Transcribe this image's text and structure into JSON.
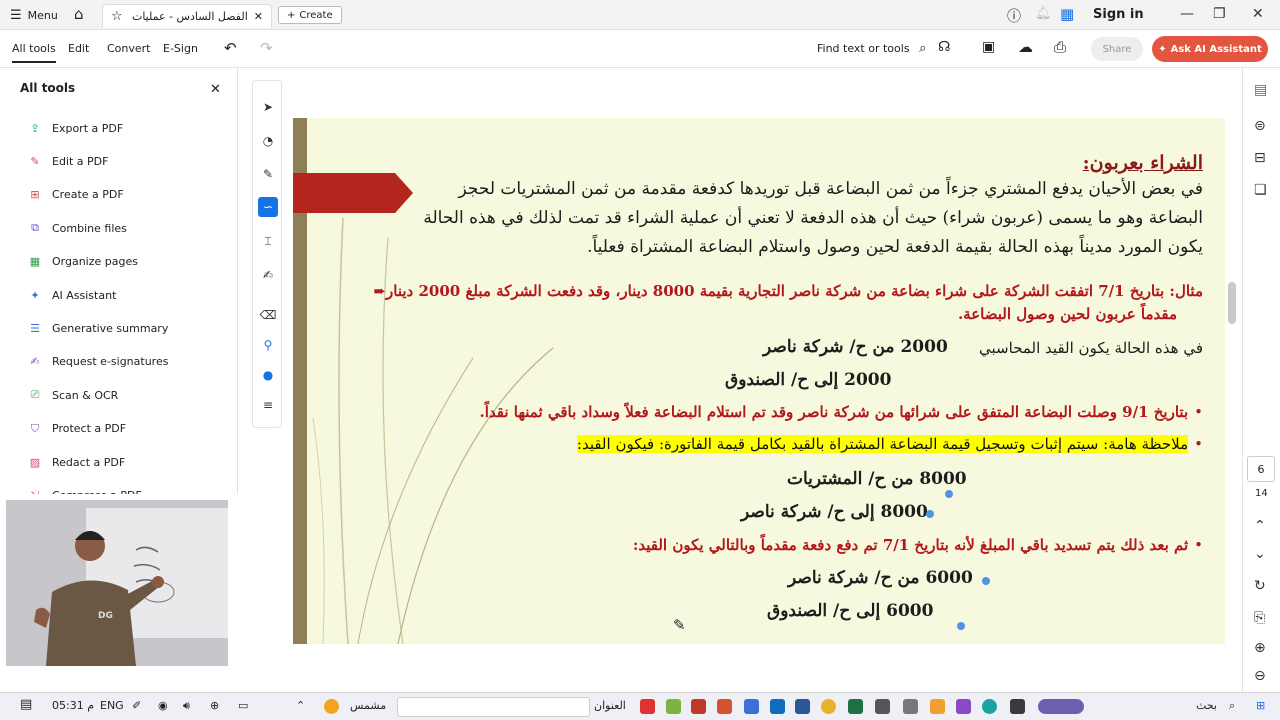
{
  "titlebar": {
    "menu_label": "Menu",
    "tab_title": "الفصل السادس - عمليات الب...",
    "create_label": "Create",
    "sign_in": "Sign in"
  },
  "menubar": {
    "all_tools": "All tools",
    "edit": "Edit",
    "convert": "Convert",
    "esign": "E-Sign",
    "find": "Find text or tools",
    "share": "Share",
    "ask_ai": "Ask AI Assistant"
  },
  "sidebar": {
    "title": "All tools",
    "items": [
      {
        "label": "Export a PDF",
        "icon": "export-icon",
        "color": "#1b9a8a"
      },
      {
        "label": "Edit a PDF",
        "icon": "edit-icon",
        "color": "#d8457a"
      },
      {
        "label": "Create a PDF",
        "icon": "create-pdf-icon",
        "color": "#d8454a"
      },
      {
        "label": "Combine files",
        "icon": "combine-icon",
        "color": "#6a56d6"
      },
      {
        "label": "Organize pages",
        "icon": "organize-icon",
        "color": "#2a9d4c"
      },
      {
        "label": "AI Assistant",
        "icon": "ai-icon",
        "color": "#3c6fd9"
      },
      {
        "label": "Generative summary",
        "icon": "summary-icon",
        "color": "#3c6fd9"
      },
      {
        "label": "Request e-signatures",
        "icon": "signature-icon",
        "color": "#8a49c6"
      },
      {
        "label": "Scan & OCR",
        "icon": "scan-icon",
        "color": "#2a9d4c"
      },
      {
        "label": "Protect a PDF",
        "icon": "protect-icon",
        "color": "#8a49c6"
      },
      {
        "label": "Redact a PDF",
        "icon": "redact-icon",
        "color": "#d8457a"
      },
      {
        "label": "Compress a PDF",
        "icon": "compress-icon",
        "color": "#d8454a"
      }
    ]
  },
  "slide": {
    "title": "الشراء بعربون:",
    "para1": "في بعض الأحيان يدفع المشتري جزءاً من ثمن البضاعة قبل توريدها كدفعة مقدمة من ثمن المشتريات لحجز",
    "para2": "البضاعة وهو ما يسمى (عربون شراء) حيث أن هذه الدفعة لا تعني أن عملية الشراء قد تمت لذلك في هذه الحالة",
    "para3": "يكون المورد مديناً بهذه الحالة بقيمة الدفعة لحين وصول واستلام البضاعة المشتراة فعلياً.",
    "example1": "مثال: بتاريخ 7/1 اتفقت الشركة على شراء بضاعة من شركة ناصر التجارية بقيمة 8000 دينار، وقد دفعت الشركة مبلغ 2000 دينار",
    "example2": "مقدماً عربون لحين وصول البضاعة.",
    "entry_intro": "في هذه الحالة يكون القيد المحاسبي",
    "entry1_dr": "2000 من ح/ شركة ناصر",
    "entry1_cr": "2000 إلى ح/ الصندوق",
    "bullet1": "بتاريخ 9/1 وصلت البضاعة المتفق على شرائها من شركة ناصر وقد تم استلام البضاعة فعلاً وسداد باقي ثمنها نقداً.",
    "note": "ملاحظة هامة: سيتم إثبات وتسجيل قيمة البضاعة المشتراة بالقيد بكامل قيمة الفاتورة: فيكون القيد:",
    "entry2_dr": "8000 من ح/ المشتريات",
    "entry2_cr": "8000 إلى ح/ شركة ناصر",
    "bullet2": "ثم بعد ذلك يتم تسديد باقي المبلغ لأنه بتاريخ 7/1 تم دفع دفعة مقدماً وبالتالي يكون القيد:",
    "entry3_dr": "6000 من ح/ شركة ناصر",
    "entry3_cr": "6000 إلى ح/ الصندوق"
  },
  "pager": {
    "current": "6",
    "total": "14"
  },
  "taskbar": {
    "search": "بحث",
    "address": "العنوان",
    "weather": "مشمس",
    "lang": "ENG",
    "time": "05:31 م"
  },
  "colors": {
    "accent": "#1473e6",
    "ask_ai": "#e4553f",
    "slide_bg": "#f6f9dd",
    "slide_red": "#b4171b",
    "highlight": "#ffff00"
  }
}
